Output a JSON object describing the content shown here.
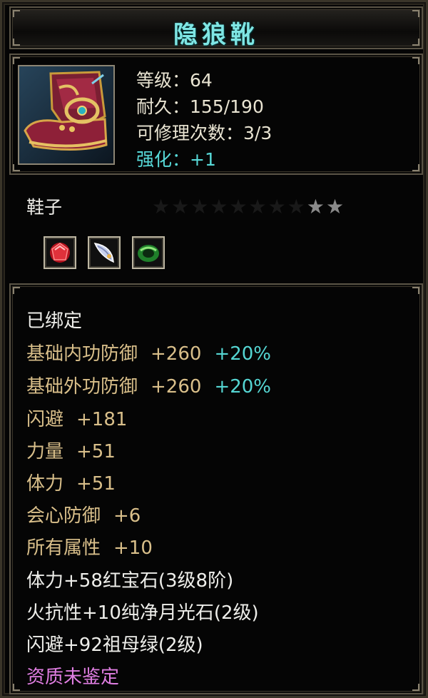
{
  "item": {
    "name": "隐狼靴",
    "level": "等级：64",
    "durability": "耐久：155/190",
    "repair_count": "可修理次数：3/3",
    "enhance": "强化：+1",
    "slot": "鞋子",
    "stars": {
      "total": 10,
      "lit": 2
    },
    "icon": "boots-icon",
    "gems": [
      {
        "icon": "ruby-gem-icon",
        "color": "#c0202a"
      },
      {
        "icon": "moonstone-gem-icon",
        "color": "#c8d0e8"
      },
      {
        "icon": "emerald-gem-icon",
        "color": "#3aa040"
      }
    ]
  },
  "attributes": {
    "bound": "已绑定",
    "inner_defense": {
      "label": "基础内功防御",
      "value": "+260",
      "bonus": "+20%"
    },
    "outer_defense": {
      "label": "基础外功防御",
      "value": "+260",
      "bonus": "+20%"
    },
    "dodge": {
      "label": "闪避",
      "value": "+181"
    },
    "strength": {
      "label": "力量",
      "value": "+51"
    },
    "stamina": {
      "label": "体力",
      "value": "+51"
    },
    "crit_defense": {
      "label": "会心防御",
      "value": "+6"
    },
    "all_attributes": {
      "label": "所有属性",
      "value": "+10"
    },
    "gem_line_1": "体力+58红宝石(3级8阶)",
    "gem_line_2": "火抗性+10纯净月光石(2级)",
    "gem_line_3": "闪避+92祖母绿(2级)",
    "quality": "资质未鉴定"
  },
  "colors": {
    "title": "#7fe6e4",
    "enhance": "#57d9d8",
    "stat_gold": "#d9bf8a",
    "bonus_cyan": "#55d6d3",
    "quality_magenta": "#e07ee2"
  }
}
